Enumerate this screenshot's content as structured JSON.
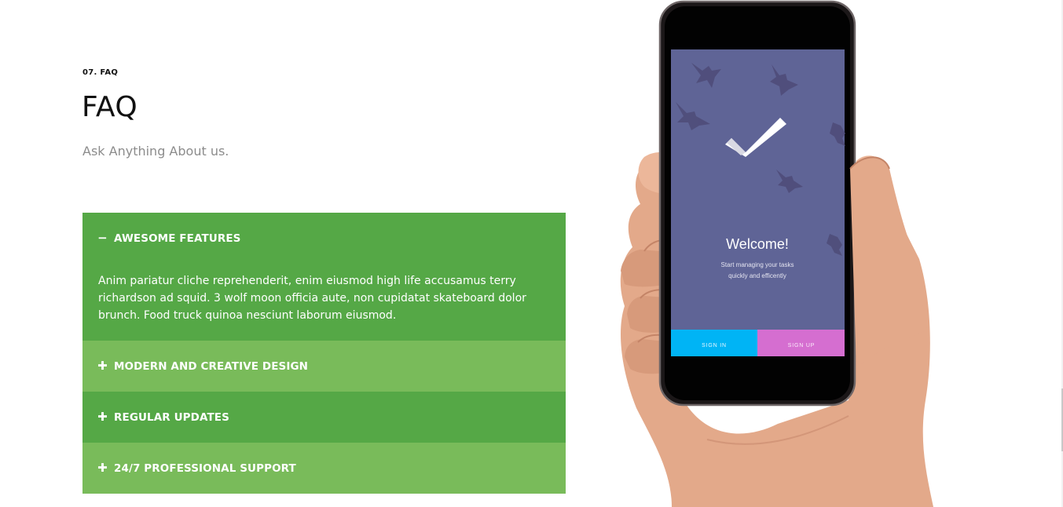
{
  "section": {
    "kicker": "07. FAQ",
    "title": "FAQ",
    "subtitle": "Ask Anything About us."
  },
  "faq": {
    "items": [
      {
        "title": "AWESOME FEATURES",
        "state": "expanded",
        "sign": "−",
        "body": "Anim pariatur cliche reprehenderit, enim eiusmod high life accusamus terry richardson ad squid. 3 wolf moon officia aute, non cupidatat skateboard dolor brunch. Food truck quinoa nesciunt laborum eiusmod."
      },
      {
        "title": "MODERN AND CREATIVE DESIGN",
        "state": "collapsed",
        "sign": "✚"
      },
      {
        "title": "REGULAR UPDATES",
        "state": "collapsed",
        "sign": "✚"
      },
      {
        "title": "24/7 PROFESSIONAL SUPPORT",
        "state": "collapsed",
        "sign": "✚"
      }
    ]
  },
  "phone_app": {
    "welcome": "Welcome!",
    "tagline_line1": "Start managing your tasks",
    "tagline_line2": "quickly and efficently",
    "signin_label": "SIGN IN",
    "signup_label": "SIGN UP"
  },
  "colors": {
    "accordion_dark": "#55a846",
    "accordion_light": "#79bb5a",
    "screen": "#5f6496",
    "signin": "#00b4f5",
    "signup": "#d56ed0"
  }
}
